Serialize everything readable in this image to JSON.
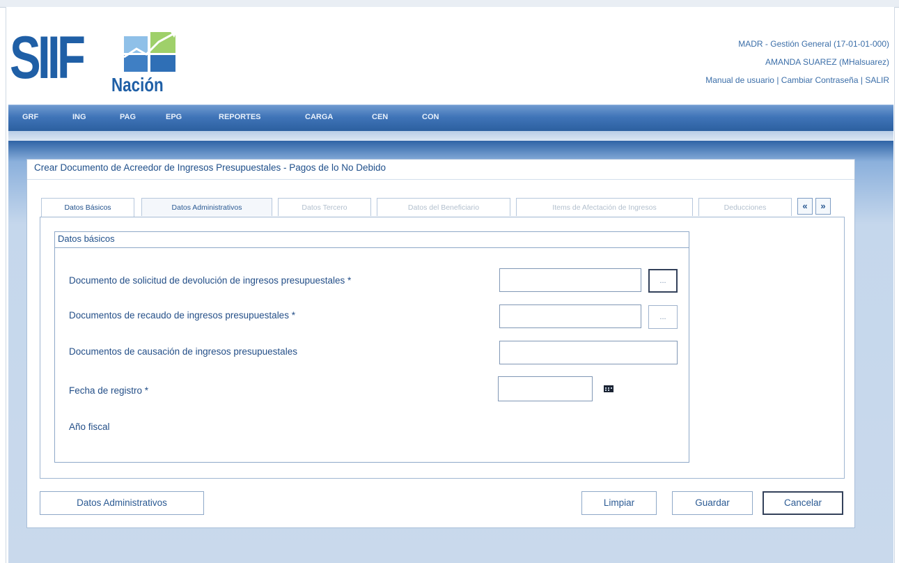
{
  "header": {
    "logo_main": "SIIF",
    "logo_sub": "Nación",
    "entity": "MADR - Gestión General (17-01-01-000)",
    "user": "AMANDA SUAREZ (MHalsuarez)",
    "links": [
      "Manual de usuario",
      "Cambiar Contraseña",
      "SALIR"
    ],
    "link_separator": "|"
  },
  "nav": {
    "items": [
      "GRF",
      "ING",
      "PAG",
      "EPG",
      "REPORTES",
      "CARGA",
      "CEN",
      "CON"
    ]
  },
  "page": {
    "title": "Crear Documento de Acreedor de Ingresos Presupuestales - Pagos de lo No Debido"
  },
  "tabs": {
    "items": [
      {
        "label": "Datos Básicos",
        "state": "active"
      },
      {
        "label": "Datos Administrativos",
        "state": "enabled"
      },
      {
        "label": "Datos Tercero",
        "state": "disabled"
      },
      {
        "label": "Datos del Beneficiario",
        "state": "disabled"
      },
      {
        "label": "Items de Afectación de Ingresos",
        "state": "disabled"
      },
      {
        "label": "Deducciones",
        "state": "disabled"
      }
    ],
    "prev": "«",
    "next": "»"
  },
  "form": {
    "legend": "Datos básicos",
    "fields": [
      {
        "label": "Documento de solicitud de devolución de ingresos presupuestales *",
        "value": "",
        "browse": "..."
      },
      {
        "label": "Documentos de recaudo de ingresos presupuestales *",
        "value": "",
        "browse": "..."
      },
      {
        "label": "Documentos de causación de ingresos presupuestales",
        "value": ""
      },
      {
        "label": "Fecha de registro *",
        "value": "",
        "icon": "calendar-icon"
      },
      {
        "label": "Año fiscal",
        "value": ""
      }
    ]
  },
  "buttons": {
    "admin": "Datos Administrativos",
    "clear": "Limpiar",
    "save": "Guardar",
    "cancel": "Cancelar"
  },
  "colors": {
    "brand": "#1f5fa6",
    "nav": "#3f74b8",
    "text": "#244f88"
  }
}
